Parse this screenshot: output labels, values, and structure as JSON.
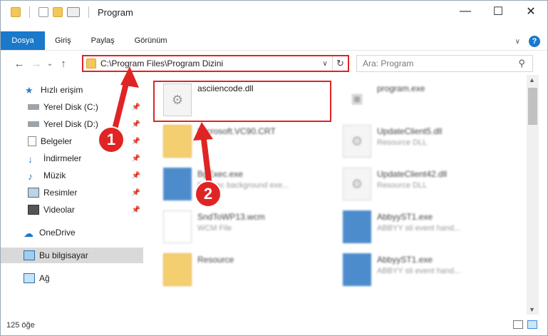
{
  "window": {
    "title": "Program",
    "minimize_glyph": "—",
    "maximize_glyph": "☐",
    "close_glyph": "✕"
  },
  "ribbon": {
    "tabs": [
      "Dosya",
      "Giriş",
      "Paylaş",
      "Görünüm"
    ],
    "help_glyph": "?"
  },
  "nav": {
    "back_glyph": "←",
    "forward_glyph": "→",
    "recent_glyph": "⌄",
    "up_glyph": "↑",
    "address": "C:\\Program Files\\Program Dizini",
    "address_dropdown_glyph": "∨",
    "refresh_glyph": "↻",
    "search_placeholder": "Ara: Program",
    "search_glyph": "⚲"
  },
  "sidebar": {
    "items": [
      {
        "label": "Hızlı erişim",
        "icon": "star-icon"
      },
      {
        "label": "Yerel Disk (C:)",
        "icon": "drive-icon"
      },
      {
        "label": "Yerel Disk (D:)",
        "icon": "drive-icon"
      },
      {
        "label": "Belgeler",
        "icon": "documents-icon"
      },
      {
        "label": "İndirmeler",
        "icon": "download-icon"
      },
      {
        "label": "Müzik",
        "icon": "music-icon"
      },
      {
        "label": "Resimler",
        "icon": "pictures-icon"
      },
      {
        "label": "Videolar",
        "icon": "video-icon"
      },
      {
        "label": "OneDrive",
        "icon": "cloud-icon"
      },
      {
        "label": "Bu bilgisayar",
        "icon": "computer-icon"
      },
      {
        "label": "Ağ",
        "icon": "network-icon"
      }
    ],
    "pin_glyph": "📌"
  },
  "files": [
    {
      "name": "asciiencode.dll",
      "sub": ""
    },
    {
      "name": "program.exe",
      "sub": ""
    },
    {
      "name": "Microsoft.VC90.CRT",
      "sub": ""
    },
    {
      "name": "UpdateClient5.dll",
      "sub": "Resource DLL"
    },
    {
      "name": "BgExec.exe",
      "sub": "BgExec background exe..."
    },
    {
      "name": "UpdateClient42.dll",
      "sub": "Resource DLL"
    },
    {
      "name": "SndToWP13.wcm",
      "sub": "WCM File"
    },
    {
      "name": "AbbyyST1.exe",
      "sub": "ABBYY sti event hand..."
    },
    {
      "name": "Resource",
      "sub": ""
    },
    {
      "name": "AbbyyST1.exe",
      "sub": "ABBYY sti event hand..."
    }
  ],
  "status": {
    "count": "125 öğe"
  },
  "annotations": {
    "step1": "1",
    "step2": "2"
  },
  "colors": {
    "accent": "#1979ca",
    "highlight": "#e02424",
    "folder": "#f3c758"
  }
}
